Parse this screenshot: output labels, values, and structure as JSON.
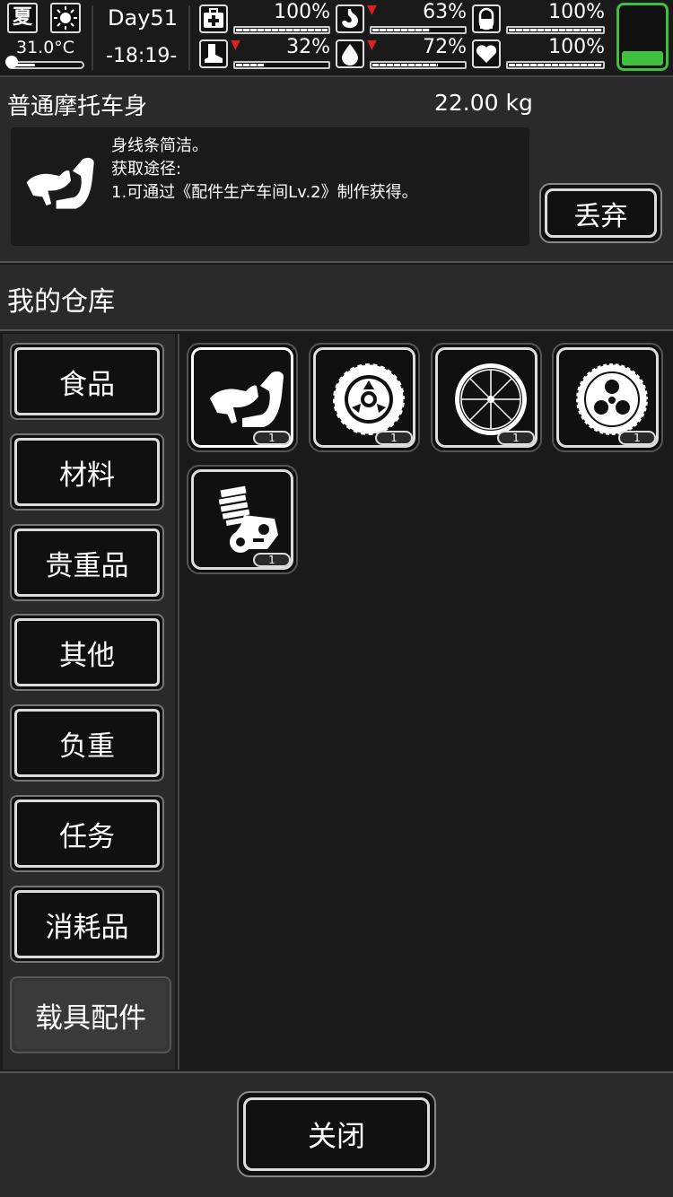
{
  "status": {
    "season": "夏",
    "weather_icon": "sun-icon",
    "temperature": "31.0°C",
    "temperature_level": 0.35,
    "day": "Day51",
    "time": "-18:19-",
    "stats": [
      {
        "name": "health",
        "icon": "medkit-icon",
        "value": "100%",
        "level": 1.0,
        "declining": false
      },
      {
        "name": "hunger",
        "icon": "stomach-icon",
        "value": "63%",
        "level": 0.63,
        "declining": true
      },
      {
        "name": "medicine",
        "icon": "pill-icon",
        "value": "100%",
        "level": 1.0,
        "declining": false
      },
      {
        "name": "stamina",
        "icon": "boot-icon",
        "value": "32%",
        "level": 0.32,
        "declining": true
      },
      {
        "name": "thirst",
        "icon": "water-drop-icon",
        "value": "72%",
        "level": 0.72,
        "declining": true
      },
      {
        "name": "mood",
        "icon": "heart-icon",
        "value": "100%",
        "level": 1.0,
        "declining": false
      }
    ],
    "battery_level": 0.25,
    "colors": {
      "battery": "#3fbf3f",
      "decline_arrow": "#e02020"
    }
  },
  "detail": {
    "name": "普通摩托车身",
    "weight": "22.00 kg",
    "description": "身线条简洁。\n获取途径:\n1.可通过《配件生产车间Lv.2》制作获得。",
    "icon": "motorcycle-body-icon",
    "discard_label": "丢弃"
  },
  "warehouse": {
    "title": "我的仓库",
    "categories": [
      {
        "label": "食品",
        "active": false
      },
      {
        "label": "材料",
        "active": false
      },
      {
        "label": "贵重品",
        "active": false
      },
      {
        "label": "其他",
        "active": false
      },
      {
        "label": "负重",
        "active": false
      },
      {
        "label": "任务",
        "active": false
      },
      {
        "label": "消耗品",
        "active": false
      },
      {
        "label": "载具配件",
        "active": true
      }
    ],
    "items": [
      {
        "icon": "motorcycle-body-icon",
        "count": "1",
        "selected": true
      },
      {
        "icon": "tire-icon",
        "count": "1",
        "selected": false
      },
      {
        "icon": "spoked-wheel-icon",
        "count": "1",
        "selected": false
      },
      {
        "icon": "wheel-hub-icon",
        "count": "1",
        "selected": false
      },
      {
        "icon": "engine-icon",
        "count": "1",
        "selected": false
      }
    ]
  },
  "footer": {
    "close_label": "关闭"
  }
}
